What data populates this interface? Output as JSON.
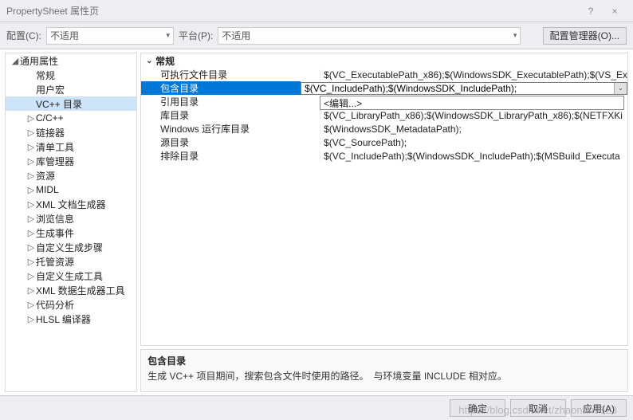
{
  "window": {
    "title": "PropertySheet 属性页",
    "help_icon": "?",
    "close_icon": "×"
  },
  "toolbar": {
    "config_label": "配置(C):",
    "config_value": "不适用",
    "platform_label": "平台(P):",
    "platform_value": "不适用",
    "config_mgr_label": "配置管理器(O)..."
  },
  "tree": {
    "root": "通用属性",
    "items": [
      {
        "label": "常规",
        "expandable": false
      },
      {
        "label": "用户宏",
        "expandable": false
      },
      {
        "label": "VC++ 目录",
        "expandable": false,
        "selected": true
      },
      {
        "label": "C/C++",
        "expandable": true
      },
      {
        "label": "链接器",
        "expandable": true
      },
      {
        "label": "清单工具",
        "expandable": true
      },
      {
        "label": "库管理器",
        "expandable": true
      },
      {
        "label": "资源",
        "expandable": true
      },
      {
        "label": "MIDL",
        "expandable": true
      },
      {
        "label": "XML 文档生成器",
        "expandable": true
      },
      {
        "label": "浏览信息",
        "expandable": true
      },
      {
        "label": "生成事件",
        "expandable": true
      },
      {
        "label": "自定义生成步骤",
        "expandable": true
      },
      {
        "label": "托管资源",
        "expandable": true
      },
      {
        "label": "自定义生成工具",
        "expandable": true
      },
      {
        "label": "XML 数据生成器工具",
        "expandable": true
      },
      {
        "label": "代码分析",
        "expandable": true
      },
      {
        "label": "HLSL 编译器",
        "expandable": true
      }
    ]
  },
  "grid": {
    "group": "常规",
    "rows": [
      {
        "name": "可执行文件目录",
        "value": "$(VC_ExecutablePath_x86);$(WindowsSDK_ExecutablePath);$(VS_Ex"
      },
      {
        "name": "包含目录",
        "value": "$(VC_IncludePath);$(WindowsSDK_IncludePath);",
        "selected": true
      },
      {
        "name": "引用目录",
        "value": ""
      },
      {
        "name": "库目录",
        "value": "$(VC_LibraryPath_x86);$(WindowsSDK_LibraryPath_x86);$(NETFXKi"
      },
      {
        "name": "Windows 运行库目录",
        "value": "$(WindowsSDK_MetadataPath);"
      },
      {
        "name": "源目录",
        "value": "$(VC_SourcePath);"
      },
      {
        "name": "排除目录",
        "value": "$(VC_IncludePath);$(WindowsSDK_IncludePath);$(MSBuild_Executa"
      }
    ],
    "dropdown_edit": "<编辑...>"
  },
  "description": {
    "title": "包含目录",
    "text": "生成 VC++ 项目期间，搜索包含文件时使用的路径。　与环境变量 INCLUDE 相对应。"
  },
  "footer": {
    "ok": "确定",
    "cancel": "取消",
    "apply": "应用(A)"
  },
  "watermark": "https://blog.csdn.net/zhaonan9523"
}
